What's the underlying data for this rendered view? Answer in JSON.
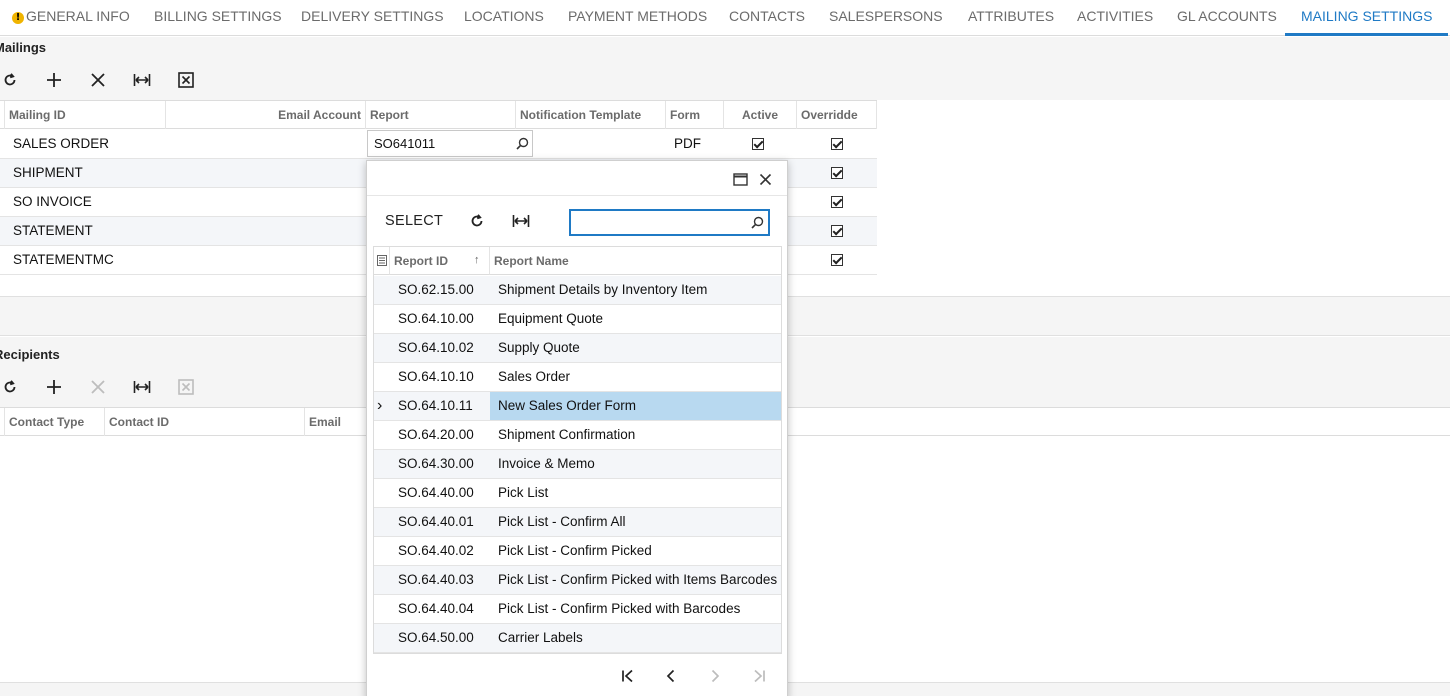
{
  "tabs": [
    {
      "label": "GENERAL INFO",
      "warning": true
    },
    {
      "label": "BILLING SETTINGS"
    },
    {
      "label": "DELIVERY SETTINGS"
    },
    {
      "label": "LOCATIONS"
    },
    {
      "label": "PAYMENT METHODS"
    },
    {
      "label": "CONTACTS"
    },
    {
      "label": "SALESPERSONS"
    },
    {
      "label": "ATTRIBUTES"
    },
    {
      "label": "ACTIVITIES"
    },
    {
      "label": "GL ACCOUNTS"
    },
    {
      "label": "MAILING SETTINGS",
      "active": true
    }
  ],
  "mailings": {
    "title": "Mailings",
    "toolbar": [
      "refresh-icon",
      "add-icon",
      "delete-icon",
      "fit-columns-icon",
      "export-excel-icon"
    ],
    "columns": [
      "Mailing ID",
      "Email Account",
      "Report",
      "Notification Template",
      "Format",
      "Active",
      "Overridde"
    ],
    "columns_display": [
      "Mailing ID",
      "Email Account",
      "Report",
      "Notification Template",
      "Form",
      "Active",
      "Overridde"
    ],
    "rows": [
      {
        "mailing_id": "SALES ORDER",
        "report": "SO641011",
        "format": "PDF",
        "active": true,
        "override": true
      },
      {
        "mailing_id": "SHIPMENT",
        "report": "",
        "format": "",
        "active": null,
        "override": true
      },
      {
        "mailing_id": "SO INVOICE",
        "report": "",
        "format": "",
        "active": null,
        "override": true
      },
      {
        "mailing_id": "STATEMENT",
        "report": "",
        "format": "",
        "active": null,
        "override": true
      },
      {
        "mailing_id": "STATEMENTMC",
        "report": "",
        "format": "",
        "active": null,
        "override": true
      }
    ]
  },
  "recipients": {
    "title": "Recipients",
    "toolbar": [
      "refresh-icon",
      "add-icon",
      "delete-icon",
      "fit-columns-icon",
      "export-excel-icon"
    ],
    "columns": [
      "Contact Type",
      "Contact ID",
      "Email"
    ]
  },
  "lookup": {
    "select_label": "SELECT",
    "search_value": "",
    "columns": [
      "Report ID",
      "Report Name"
    ],
    "selected_index": 4,
    "rows": [
      {
        "id": "SO.62.15.00",
        "name": "Shipment Details by Inventory Item"
      },
      {
        "id": "SO.64.10.00",
        "name": "Equipment Quote"
      },
      {
        "id": "SO.64.10.02",
        "name": "Supply Quote"
      },
      {
        "id": "SO.64.10.10",
        "name": "Sales Order"
      },
      {
        "id": "SO.64.10.11",
        "name": "New Sales Order Form"
      },
      {
        "id": "SO.64.20.00",
        "name": "Shipment Confirmation"
      },
      {
        "id": "SO.64.30.00",
        "name": "Invoice & Memo"
      },
      {
        "id": "SO.64.40.00",
        "name": "Pick List"
      },
      {
        "id": "SO.64.40.01",
        "name": "Pick List - Confirm All"
      },
      {
        "id": "SO.64.40.02",
        "name": "Pick List - Confirm Picked"
      },
      {
        "id": "SO.64.40.03",
        "name": "Pick List - Confirm Picked with Items Barcodes"
      },
      {
        "id": "SO.64.40.04",
        "name": "Pick List - Confirm Picked with Barcodes"
      },
      {
        "id": "SO.64.50.00",
        "name": "Carrier Labels"
      }
    ]
  },
  "colors": {
    "accent": "#1f7ac5",
    "selected_row": "#b8d9f0",
    "warning": "#f0b400"
  }
}
